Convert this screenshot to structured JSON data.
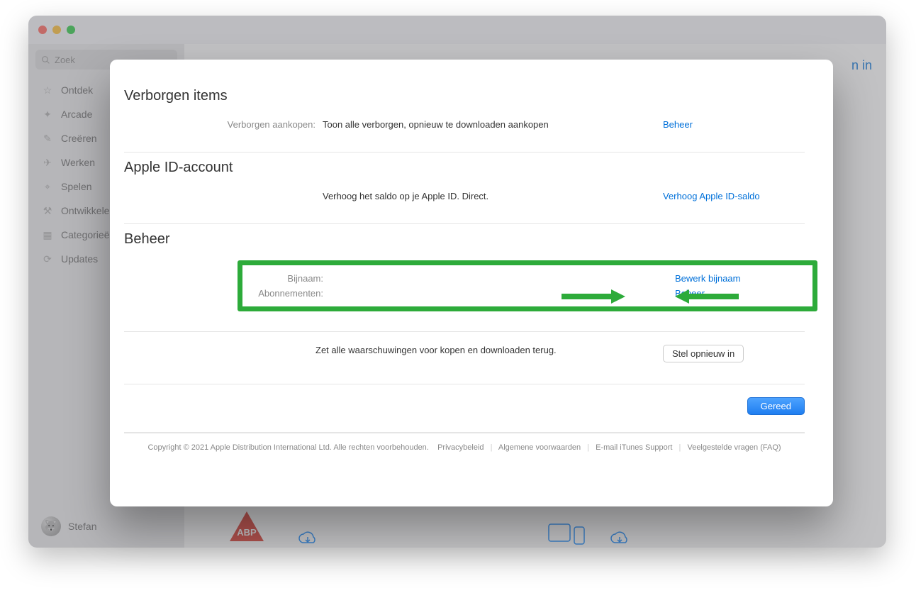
{
  "search_placeholder": "Zoek",
  "sidebar": {
    "items": [
      {
        "label": "Ontdek"
      },
      {
        "label": "Arcade"
      },
      {
        "label": "Creëren"
      },
      {
        "label": "Werken"
      },
      {
        "label": "Spelen"
      },
      {
        "label": "Ontwikkelen"
      },
      {
        "label": "Categorieën"
      },
      {
        "label": "Updates"
      }
    ]
  },
  "user_name": "Stefan",
  "bg_login_fragment": "n in",
  "modal": {
    "sections": {
      "hidden": {
        "title": "Verborgen items",
        "label": "Verborgen aankopen:",
        "desc": "Toon alle verborgen, opnieuw te downloaden aankopen",
        "action": "Beheer"
      },
      "apple_id": {
        "title": "Apple ID-account",
        "desc": "Verhoog het saldo op je Apple ID. Direct.",
        "action": "Verhoog Apple ID-saldo"
      },
      "manage": {
        "title": "Beheer",
        "nickname_label": "Bijnaam:",
        "nickname_action": "Bewerk bijnaam",
        "subs_label": "Abonnementen:",
        "subs_action": "Beheer"
      },
      "reset": {
        "desc": "Zet alle waarschuwingen voor kopen en downloaden terug.",
        "button": "Stel opnieuw in"
      }
    },
    "done": "Gereed",
    "footer": {
      "copyright": "Copyright © 2021 Apple Distribution International Ltd. Alle rechten voorbehouden.",
      "privacy": "Privacybeleid",
      "terms": "Algemene voorwaarden",
      "support": "E-mail iTunes Support",
      "faq": "Veelgestelde vragen (FAQ)"
    }
  }
}
